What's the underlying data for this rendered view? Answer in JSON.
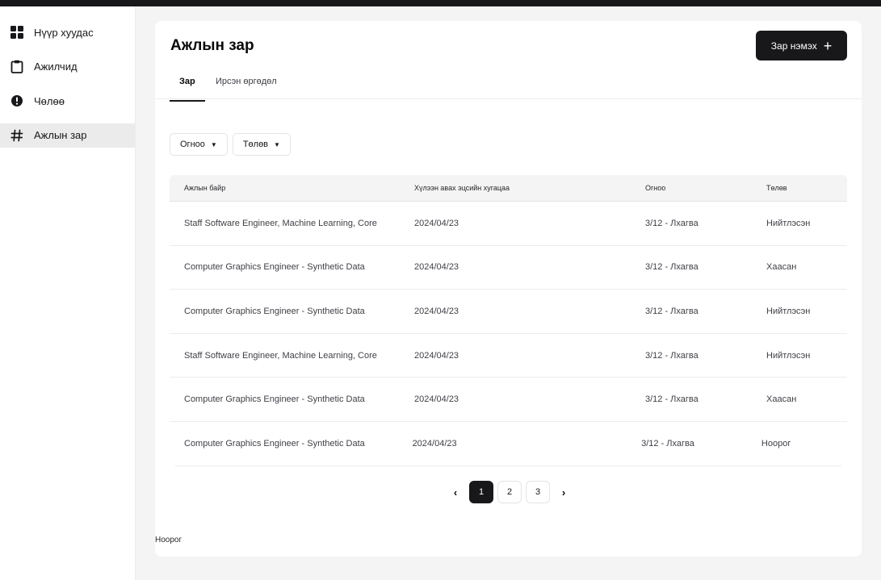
{
  "sidebar": {
    "items": [
      {
        "label": "Нүүр хуудас",
        "icon": "grid-icon",
        "active": false
      },
      {
        "label": "Ажилчид",
        "icon": "clipboard-icon",
        "active": false
      },
      {
        "label": "Чөлөө",
        "icon": "alert-circle-icon",
        "active": false
      },
      {
        "label": "Ажлын зар",
        "icon": "hash-icon",
        "active": true
      }
    ]
  },
  "main": {
    "title": "Ажлын зар",
    "add_button": "Зар нэмэх",
    "tabs": [
      "Зар",
      "Ирсэн өргөдөл"
    ],
    "filters": [
      "Огноо",
      "Төлөв"
    ],
    "table": {
      "headers": [
        "Ажлын байр",
        "Хүлээн авах эцсийн хугацаа",
        "Огноо",
        "Төлөв"
      ],
      "rows": [
        [
          "Staff Software Engineer, Machine Learning, Core",
          "2024/04/23",
          "3/12 - Лхагва",
          "Нийтлэсэн"
        ],
        [
          "Computer Graphics Engineer - Synthetic Data",
          "2024/04/23",
          "3/12 - Лхагва",
          "Хаасан"
        ],
        [
          "Computer Graphics Engineer - Synthetic Data",
          "2024/04/23",
          "3/12 - Лхагва",
          "Нийтлэсэн"
        ],
        [
          "Staff Software Engineer, Machine Learning, Core",
          "2024/04/23",
          "3/12 - Лхагва",
          "Нийтлэсэн"
        ],
        [
          "Computer Graphics Engineer - Synthetic Data",
          "2024/04/23",
          "3/12 - Лхагва",
          "Хаасан"
        ],
        [
          "Computer Graphics Engineer - Synthetic Data",
          "2024/04/23",
          "3/12 - Лхагва",
          "Ноорог"
        ]
      ]
    },
    "pagination": {
      "pages": [
        "1",
        "2",
        "3"
      ],
      "current": "1",
      "prev": "‹",
      "next": "›"
    },
    "footer_note": "Ноорог"
  },
  "colors": {
    "primary": "#18181b",
    "background": "#f4f4f5",
    "card": "#ffffff"
  }
}
